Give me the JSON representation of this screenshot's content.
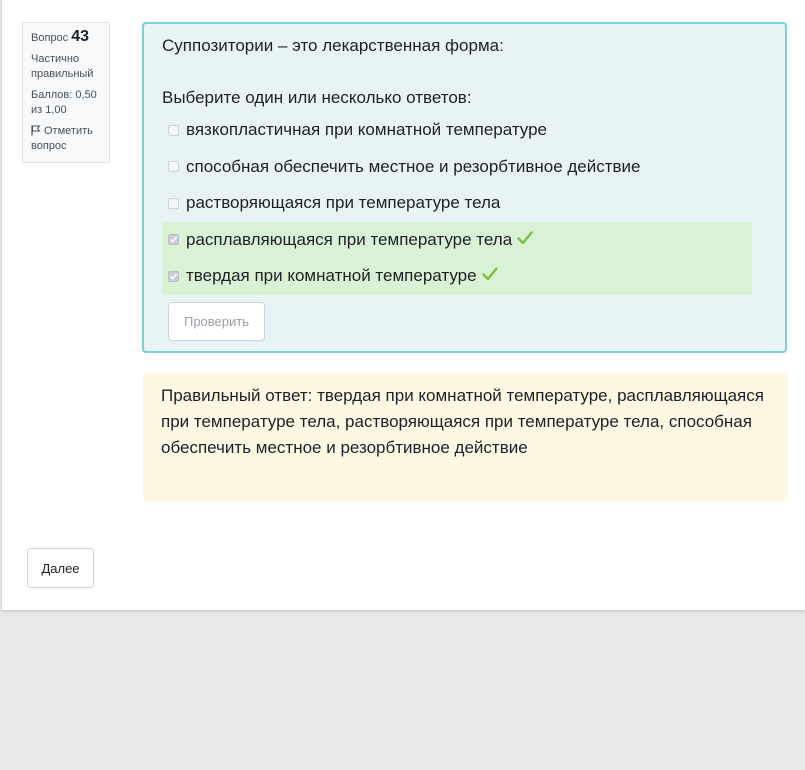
{
  "question_info": {
    "label": "Вопрос",
    "number": "43",
    "state": "Частично правильный",
    "grade": "Баллов: 0,50 из 1,00",
    "flag_label": "Отметить вопрос"
  },
  "question": {
    "text": "Суппозитории – это лекарственная форма:",
    "prompt": "Выберите один или несколько ответов:",
    "answers": [
      {
        "label": "вязкопластичная при комнатной температуре",
        "checked": false,
        "correct": false
      },
      {
        "label": "способная обеспечить местное и резорбтивное действие",
        "checked": false,
        "correct": false
      },
      {
        "label": "растворяющаяся при температуре тела",
        "checked": false,
        "correct": false
      },
      {
        "label": "расплавляющаяся при температуре тела",
        "checked": true,
        "correct": true
      },
      {
        "label": "твердая при комнатной температуре",
        "checked": true,
        "correct": true
      }
    ],
    "check_button": "Проверить"
  },
  "feedback": {
    "right_answer": "Правильный ответ: твердая при комнатной температуре, расплавляющаяся при температуре тела, растворяющаяся при температуре тела, способная обеспечить местное и резорбтивное действие"
  },
  "navigation": {
    "next_button": "Далее"
  },
  "colors": {
    "formulation_bg": "#e7f3f5",
    "formulation_border": "#7bcfdc",
    "correct_bg": "#d9f2d6",
    "tick": "#7ac143",
    "feedback_bg": "#fcf8e3"
  }
}
